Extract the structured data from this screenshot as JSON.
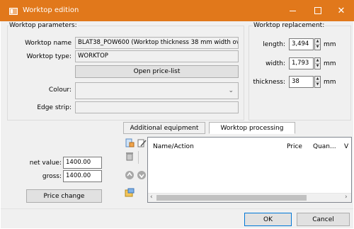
{
  "window": {
    "title": "Worktop edition",
    "controls": {
      "minimize": "—",
      "maximize": "□",
      "close": "✕"
    }
  },
  "params": {
    "legend": "Worktop parameters:",
    "name_label": "Worktop name",
    "name_value": "BLAT38_POW600 (Worktop thickness 38 mm width ove",
    "type_label": "Worktop type:",
    "type_value": "WORKTOP",
    "price_list_button": "Open price-list",
    "colour_label": "Colour:",
    "colour_value": "",
    "edge_label": "Edge strip:",
    "edge_value": ""
  },
  "replacement": {
    "legend": "Worktop replacement:",
    "length_label": "length:",
    "length_value": "3,494",
    "width_label": "width:",
    "width_value": "1,793",
    "thickness_label": "thickness:",
    "thickness_value": "38",
    "unit": "mm"
  },
  "tabs": {
    "additional": "Additional equipment",
    "processing": "Worktop processing"
  },
  "grid": {
    "columns": [
      "Name/Action",
      "Price",
      "Quan...",
      "V"
    ]
  },
  "values": {
    "net_label": "net value:",
    "net_value": "1400.00",
    "gross_label": "gross:",
    "gross_value": "1400.00",
    "price_change_button": "Price change"
  },
  "footer": {
    "ok": "OK",
    "cancel": "Cancel"
  },
  "colors": {
    "titlebar": "#e1781b",
    "panel": "#f0f0f0",
    "accent": "#0078d7"
  }
}
